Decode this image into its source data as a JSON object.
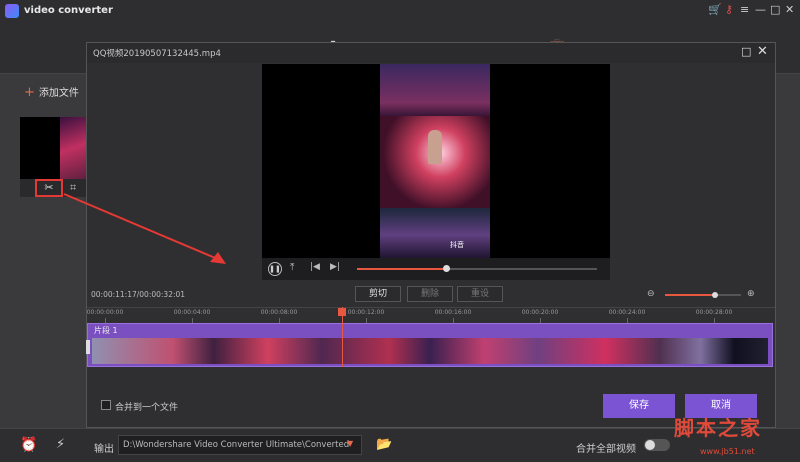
{
  "app": {
    "title": "video converter",
    "toolbar": {
      "convert_icon": "convert-icon",
      "download_icon": "download-icon",
      "record_icon": "record-icon",
      "transfer_icon": "transfer-icon",
      "toolbox_icon": "toolbox-icon"
    },
    "add_files_label": "添加文件",
    "footer": {
      "output_label": "输出",
      "output_path": "D:\\Wondershare Video Converter Ultimate\\Converted",
      "merge_all_label": "合并全部视频"
    }
  },
  "dialog": {
    "title": "QQ视频20190507132445.mp4",
    "video_overlay": "抖音",
    "player": {
      "progress": 0.37
    },
    "edit": {
      "timecode": "00:00:11:17/00:00:32:01",
      "cut_label": "剪切",
      "delete_label": "删除",
      "reset_label": "重设",
      "zoom_level": 0.66
    },
    "ruler_ticks": [
      "00:00:00:00",
      "00:00:04:00",
      "00:00:08:00",
      "00:00:12:00",
      "00:00:16:00",
      "00:00:20:00",
      "00:00:24:00",
      "00:00:28:00"
    ],
    "clip_label": "片段 1",
    "merge_label": "合并到一个文件",
    "save_label": "保存",
    "cancel_label": "取消"
  },
  "watermark": {
    "text": "脚本之家",
    "url": "www.jb51.net"
  },
  "colors": {
    "accent": "#7b54d4",
    "highlight": "#e8573f",
    "annotation": "#e53935"
  }
}
